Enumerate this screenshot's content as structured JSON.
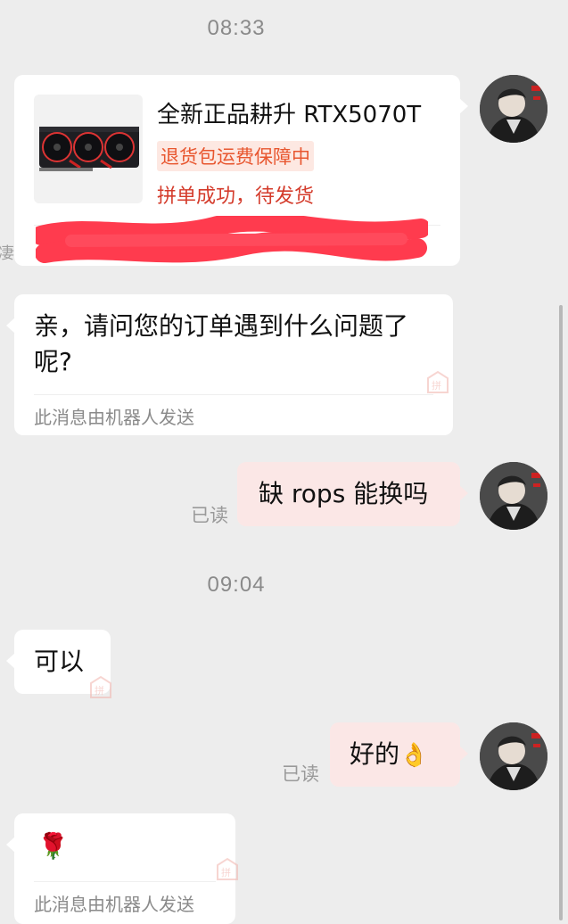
{
  "conversation": {
    "timestamps": [
      "08:33",
      "09:04"
    ],
    "product_card": {
      "title": "全新正品耕升 RTX5070T",
      "badge": "退货包运费保障中",
      "status": "拼单成功，待发货",
      "edge_fragment": "凄"
    },
    "messages": [
      {
        "side": "left",
        "text": "亲，请问您的订单遇到什么问题了呢?",
        "note": "此消息由机器人发送"
      },
      {
        "side": "right",
        "text": "缺 rops 能换吗",
        "read": "已读"
      },
      {
        "side": "left",
        "text": "可以"
      },
      {
        "side": "right",
        "text": "好的",
        "emoji": "👌",
        "read": "已读"
      },
      {
        "side": "left",
        "emoji": "🌹",
        "note": "此消息由机器人发送"
      }
    ]
  },
  "icons": {
    "avatar": "user-avatar",
    "stamp": "pinduoduo-stamp-icon",
    "ok": "ok-hand-icon",
    "rose": "rose-icon"
  },
  "colors": {
    "background": "#ededed",
    "bubble_self": "#fbe7e6",
    "badge_text": "#e8562f",
    "status_text": "#d43b2b",
    "redaction": "#ff3b4e"
  }
}
